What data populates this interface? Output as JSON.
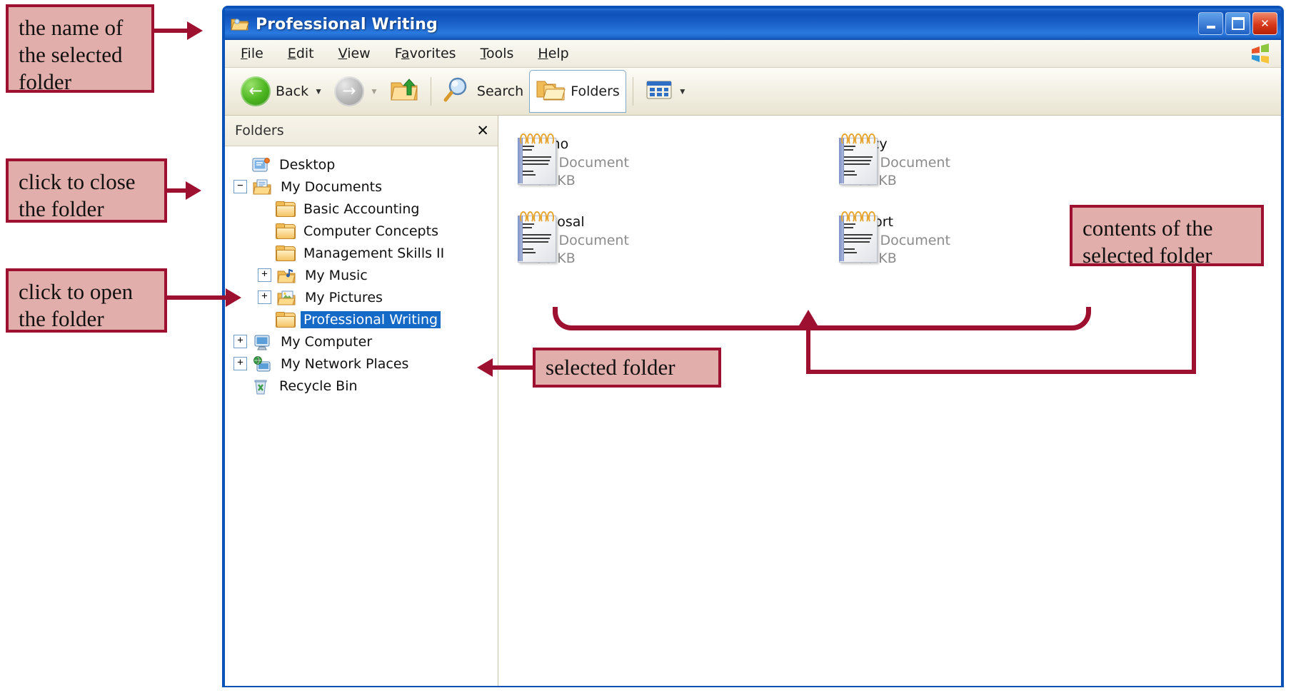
{
  "window": {
    "title": "Professional Writing",
    "title_icon": "folder-open-icon",
    "buttons": {
      "minimize": "_",
      "maximize": "□",
      "close": "✕"
    }
  },
  "menu": {
    "items": [
      {
        "label": "File",
        "accel": "F"
      },
      {
        "label": "Edit",
        "accel": "E"
      },
      {
        "label": "View",
        "accel": "V"
      },
      {
        "label": "Favorites",
        "accel": "a"
      },
      {
        "label": "Tools",
        "accel": "T"
      },
      {
        "label": "Help",
        "accel": "H"
      }
    ]
  },
  "toolbar": {
    "back_label": "Back",
    "search_label": "Search",
    "folders_label": "Folders",
    "up_icon": "folder-up-icon",
    "views_icon": "views-icon"
  },
  "explorer_bar": {
    "header": "Folders",
    "close_label": "✕",
    "tree": [
      {
        "label": "Desktop",
        "icon": "desktop-icon",
        "indent": 0,
        "expander": "",
        "selected": false
      },
      {
        "label": "My Documents",
        "icon": "my-documents-icon",
        "indent": 0,
        "expander": "−",
        "selected": false
      },
      {
        "label": "Basic Accounting",
        "icon": "folder-icon",
        "indent": 1,
        "expander": "",
        "selected": false
      },
      {
        "label": "Computer Concepts",
        "icon": "folder-icon",
        "indent": 1,
        "expander": "",
        "selected": false
      },
      {
        "label": "Management Skills II",
        "icon": "folder-icon",
        "indent": 1,
        "expander": "",
        "selected": false
      },
      {
        "label": "My Music",
        "icon": "my-music-icon",
        "indent": 1,
        "expander": "+",
        "selected": false
      },
      {
        "label": "My Pictures",
        "icon": "my-pictures-icon",
        "indent": 1,
        "expander": "+",
        "selected": false
      },
      {
        "label": "Professional Writing",
        "icon": "folder-icon",
        "indent": 1,
        "expander": "",
        "selected": true
      },
      {
        "label": "My Computer",
        "icon": "my-computer-icon",
        "indent": 0,
        "expander": "+",
        "selected": false
      },
      {
        "label": "My Network Places",
        "icon": "network-icon",
        "indent": 0,
        "expander": "+",
        "selected": false
      },
      {
        "label": "Recycle Bin",
        "icon": "recycle-bin-icon",
        "indent": 0,
        "expander": "",
        "selected": false
      }
    ]
  },
  "files": [
    {
      "name": "Memo",
      "type": "Text Document",
      "size": "106 KB",
      "icon": "text-document-icon"
    },
    {
      "name": "Policy",
      "type": "Text Document",
      "size": "133 KB",
      "icon": "text-document-icon"
    },
    {
      "name": "Proposal",
      "type": "Text Document",
      "size": "136 KB",
      "icon": "text-document-icon"
    },
    {
      "name": "Report",
      "type": "Text Document",
      "size": "166 KB",
      "icon": "text-document-icon"
    }
  ],
  "annotations": [
    {
      "id": "name-of-selected-folder",
      "text": "the name of the selected folder"
    },
    {
      "id": "click-to-close",
      "text": "click to close the folder"
    },
    {
      "id": "click-to-open",
      "text": "click to open the folder"
    },
    {
      "id": "selected-folder",
      "text": "selected folder"
    },
    {
      "id": "contents-of-selected",
      "text": "contents of the selected folder"
    }
  ],
  "colors": {
    "callout_fill": "#e2aeab",
    "callout_border": "#9e1030",
    "title_bar": "#0f53ba",
    "selection": "#1569c7"
  }
}
